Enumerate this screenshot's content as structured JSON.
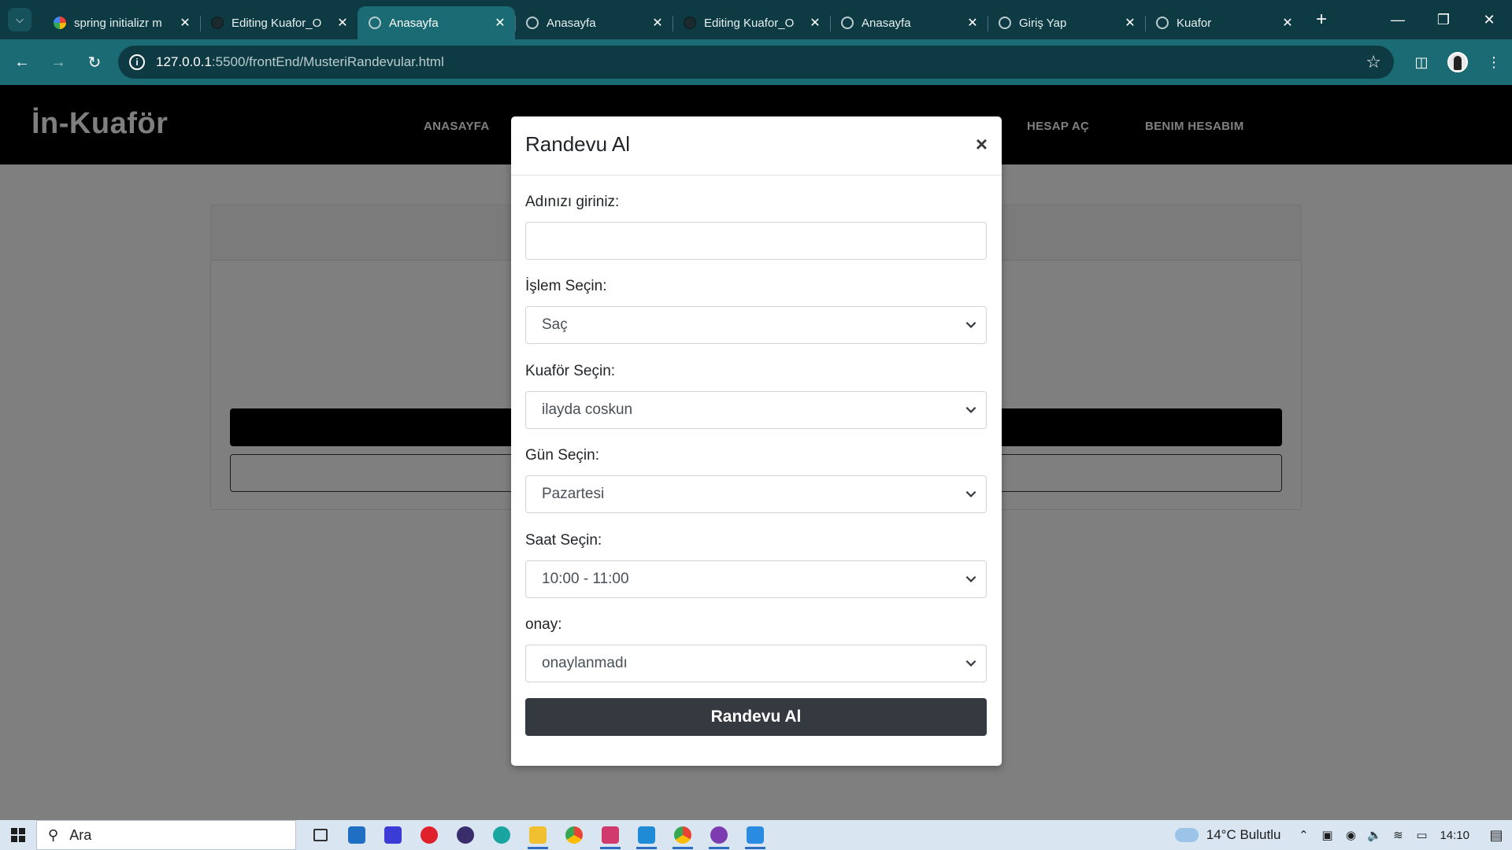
{
  "browser": {
    "tabs": [
      {
        "title": "spring initializr m",
        "favicon": "google-icon",
        "active": false
      },
      {
        "title": "Editing Kuafor_O",
        "favicon": "github-icon",
        "active": false
      },
      {
        "title": "Anasayfa",
        "favicon": "globe-icon",
        "active": true
      },
      {
        "title": "Anasayfa",
        "favicon": "globe-icon",
        "active": false
      },
      {
        "title": "Editing Kuafor_O",
        "favicon": "github-icon",
        "active": false
      },
      {
        "title": "Anasayfa",
        "favicon": "globe-icon",
        "active": false
      },
      {
        "title": "Giriş Yap",
        "favicon": "globe-icon",
        "active": false
      },
      {
        "title": "Kuafor",
        "favicon": "globe-icon",
        "active": false
      }
    ],
    "url_host": "127.0.0.1",
    "url_path": ":5500/frontEnd/MusteriRandevular.html",
    "colors": {
      "tabstrip": "#0e3b43",
      "toolbar": "#1a6b73"
    }
  },
  "site": {
    "logo": "İn-Kuaför",
    "nav": [
      "ANASAYFA",
      "HESAP AÇ",
      "BENIM HESABIM"
    ]
  },
  "modal": {
    "title": "Randevu Al",
    "close_symbol": "×",
    "fields": [
      {
        "label": "Adınızı giriniz:",
        "type": "text",
        "value": ""
      },
      {
        "label": "İşlem Seçin:",
        "type": "select",
        "value": "Saç"
      },
      {
        "label": "Kuaför Seçin:",
        "type": "select",
        "value": "ilayda coskun"
      },
      {
        "label": "Gün Seçin:",
        "type": "select",
        "value": "Pazartesi"
      },
      {
        "label": "Saat Seçin:",
        "type": "select",
        "value": "10:00 - 11:00"
      },
      {
        "label": "onay:",
        "type": "select",
        "value": "onaylanmadı"
      }
    ],
    "submit_label": "Randevu Al",
    "colors": {
      "button": "#343a40"
    }
  },
  "taskbar": {
    "search_placeholder": "Ara",
    "weather": "14°C  Bulutlu",
    "time": "14:10"
  }
}
